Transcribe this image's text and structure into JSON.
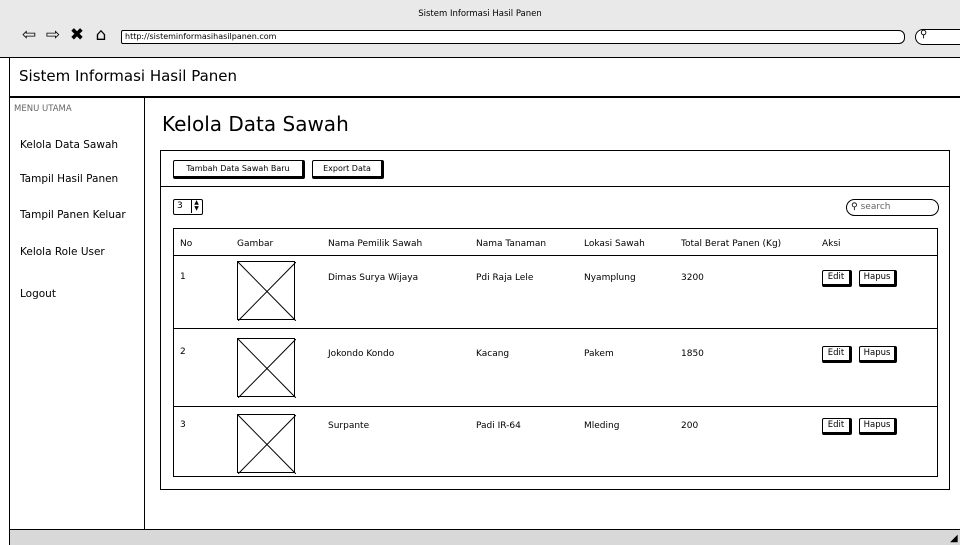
{
  "browser": {
    "window_title": "Sistem Informasi Hasil Panen",
    "url": "http://sisteminformasihasilpanen.com",
    "nav_icons": [
      "back-arrow-icon",
      "forward-arrow-icon",
      "close-icon",
      "home-icon"
    ],
    "search_icon": "search-icon"
  },
  "app": {
    "title": "Sistem Informasi Hasil Panen"
  },
  "sidebar": {
    "heading": "MENU UTAMA",
    "items": [
      {
        "label": "Kelola Data Sawah"
      },
      {
        "label": "Tampil Hasil Panen"
      },
      {
        "label": "Tampil Panen Keluar"
      },
      {
        "label": "Kelola Role User"
      },
      {
        "label": "Logout"
      }
    ]
  },
  "main": {
    "title": "Kelola Data Sawah",
    "toolbar": {
      "add_label": "Tambah Data Sawah Baru",
      "export_label": "Export Data"
    },
    "page_size": "3",
    "search_placeholder": "search",
    "table": {
      "headers": [
        "No",
        "Gambar",
        "Nama Pemilik Sawah",
        "Nama Tanaman",
        "Lokasi Sawah",
        "Total Berat Panen (Kg)",
        "Aksi"
      ],
      "rows": [
        {
          "no": "1",
          "owner": "Dimas Surya Wijaya",
          "crop": "Pdi Raja Lele",
          "location": "Nyamplung",
          "weight": "3200"
        },
        {
          "no": "2",
          "owner": "Jokondo Kondo",
          "crop": "Kacang",
          "location": "Pakem",
          "weight": "1850"
        },
        {
          "no": "3",
          "owner": "Surpante",
          "crop": "Padi IR-64",
          "location": "Mleding",
          "weight": "200"
        }
      ],
      "edit_label": "Edit",
      "delete_label": "Hapus"
    }
  }
}
